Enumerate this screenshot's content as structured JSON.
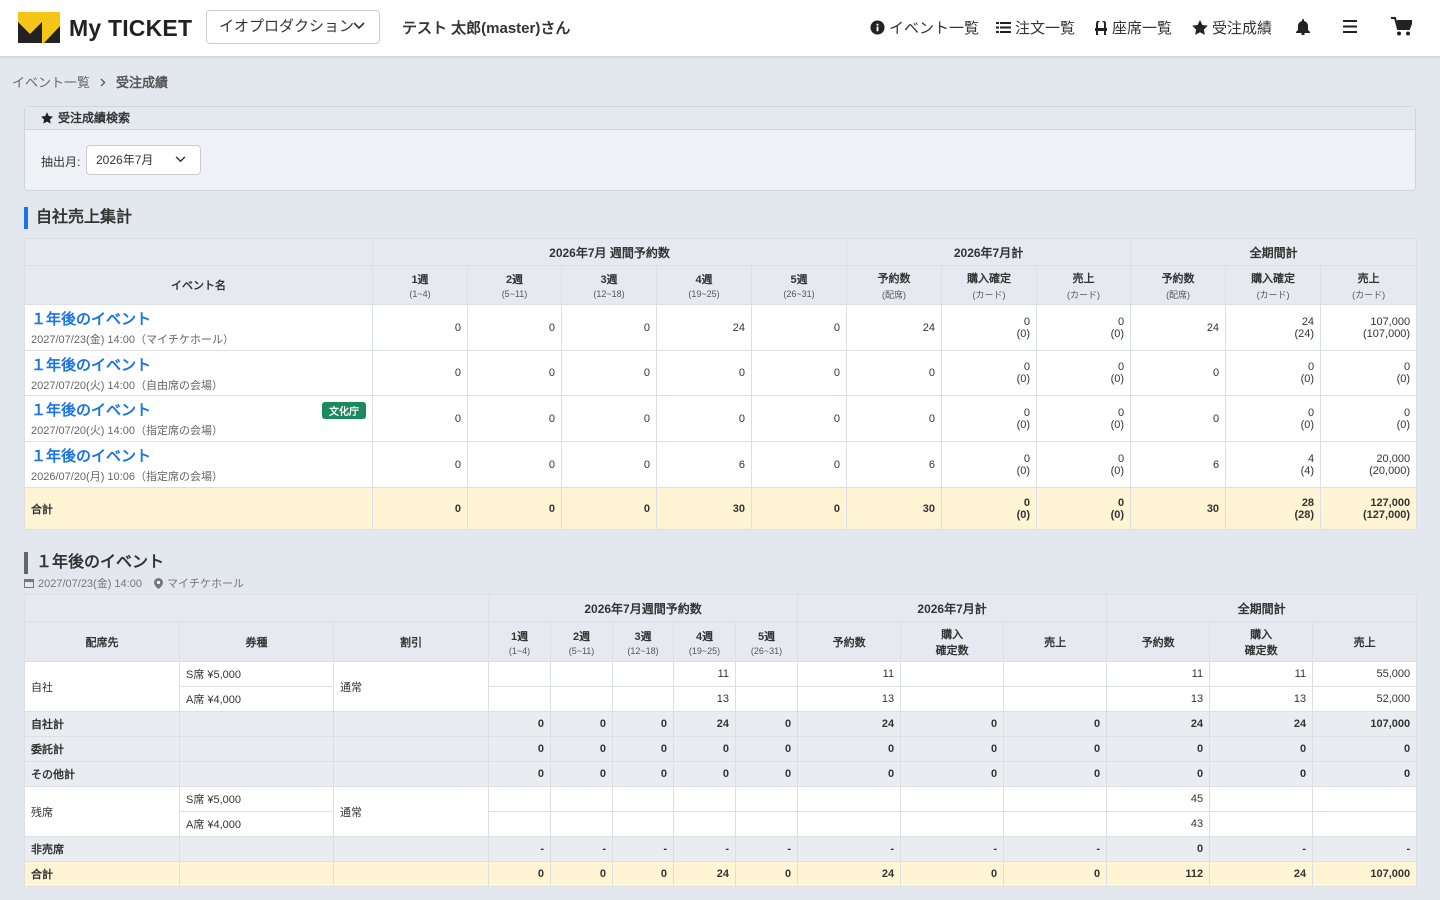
{
  "header": {
    "brand": "My TICKET",
    "org": "イオプロダクション",
    "user": "テスト 太郎(master)さん",
    "nav": {
      "events": "イベント一覧",
      "orders": "注文一覧",
      "seats": "座席一覧",
      "performance": "受注成績"
    }
  },
  "breadcrumb": {
    "home": "イベント一覧",
    "current": "受注成績"
  },
  "search": {
    "title": "受注成績検索",
    "month_label": "抽出月:",
    "month_value": "2026年7月"
  },
  "summary": {
    "title": "自社売上集計",
    "groups": [
      "2026年7月 週間予約数",
      "2026年7月計",
      "全期間計"
    ],
    "col_event": "イベント名",
    "weeks": [
      {
        "l": "1週",
        "r": "(1~4)"
      },
      {
        "l": "2週",
        "r": "(5~11)"
      },
      {
        "l": "3週",
        "r": "(12~18)"
      },
      {
        "l": "4週",
        "r": "(19~25)"
      },
      {
        "l": "5週",
        "r": "(26~31)"
      }
    ],
    "monthcols": [
      {
        "l": "予約数",
        "r": "(配席)"
      },
      {
        "l": "購入確定",
        "r": "(カード)"
      },
      {
        "l": "売上",
        "r": "(カード)"
      }
    ],
    "allcols": [
      {
        "l": "予約数",
        "r": "(配席)"
      },
      {
        "l": "購入確定",
        "r": "(カード)"
      },
      {
        "l": "売上",
        "r": "(カード)"
      }
    ],
    "rows": [
      {
        "name": "１年後のイベント",
        "sub": "2027/07/23(金) 14:00（マイチケホール）",
        "badge": "",
        "w": [
          "0",
          "0",
          "0",
          "24",
          "0"
        ],
        "m": [
          "24",
          "0",
          "(0)",
          "0",
          "(0)"
        ],
        "a": [
          "24",
          "24",
          "(24)",
          "107,000",
          "(107,000)"
        ]
      },
      {
        "name": "１年後のイベント",
        "sub": "2027/07/20(火) 14:00（自由席の会場）",
        "badge": "",
        "w": [
          "0",
          "0",
          "0",
          "0",
          "0"
        ],
        "m": [
          "0",
          "0",
          "(0)",
          "0",
          "(0)"
        ],
        "a": [
          "0",
          "0",
          "(0)",
          "0",
          "(0)"
        ]
      },
      {
        "name": "１年後のイベント",
        "sub": "2027/07/20(火) 14:00（指定席の会場）",
        "badge": "文化庁",
        "w": [
          "0",
          "0",
          "0",
          "0",
          "0"
        ],
        "m": [
          "0",
          "0",
          "(0)",
          "0",
          "(0)"
        ],
        "a": [
          "0",
          "0",
          "(0)",
          "0",
          "(0)"
        ]
      },
      {
        "name": "１年後のイベント",
        "sub": "2026/07/20(月) 10:06（指定席の会場）",
        "badge": "",
        "w": [
          "0",
          "0",
          "0",
          "6",
          "0"
        ],
        "m": [
          "6",
          "0",
          "(0)",
          "0",
          "(0)"
        ],
        "a": [
          "6",
          "4",
          "(4)",
          "20,000",
          "(20,000)"
        ]
      }
    ],
    "total": {
      "label": "合計",
      "w": [
        "0",
        "0",
        "0",
        "30",
        "0"
      ],
      "m": [
        "30",
        "0",
        "(0)",
        "0",
        "(0)"
      ],
      "a": [
        "30",
        "28",
        "(28)",
        "127,000",
        "(127,000)"
      ]
    }
  },
  "detail": {
    "title": "１年後のイベント",
    "datetime": "2027/07/23(金) 14:00",
    "venue": "マイチケホール",
    "groups": [
      "2026年7月週間予約数",
      "2026年7月計",
      "全期間計"
    ],
    "cols": {
      "dest": "配席先",
      "ticket": "券種",
      "discount": "割引"
    },
    "weeks": [
      {
        "l": "1週",
        "r": "(1~4)"
      },
      {
        "l": "2週",
        "r": "(5~11)"
      },
      {
        "l": "3週",
        "r": "(12~18)"
      },
      {
        "l": "4週",
        "r": "(19~25)"
      },
      {
        "l": "5週",
        "r": "(26~31)"
      }
    ],
    "mcols": [
      "予約数",
      "購入確定数",
      "売上"
    ],
    "acols": [
      "予約数",
      "購入確定数",
      "売上"
    ],
    "own": {
      "dest": "自社",
      "discount": "通常",
      "rows": [
        {
          "ticket": "S席 ¥5,000",
          "v": [
            "",
            "",
            "",
            "11",
            "",
            "11",
            "",
            "",
            "11",
            "11",
            "55,000"
          ]
        },
        {
          "ticket": "A席 ¥4,000",
          "v": [
            "",
            "",
            "",
            "13",
            "",
            "13",
            "",
            "",
            "13",
            "13",
            "52,000"
          ]
        }
      ]
    },
    "subtotals": [
      {
        "label": "自社計",
        "v": [
          "0",
          "0",
          "0",
          "24",
          "0",
          "24",
          "0",
          "0",
          "24",
          "24",
          "107,000"
        ]
      },
      {
        "label": "委託計",
        "v": [
          "0",
          "0",
          "0",
          "0",
          "0",
          "0",
          "0",
          "0",
          "0",
          "0",
          "0"
        ]
      },
      {
        "label": "その他計",
        "v": [
          "0",
          "0",
          "0",
          "0",
          "0",
          "0",
          "0",
          "0",
          "0",
          "0",
          "0"
        ]
      }
    ],
    "remain": {
      "dest": "残席",
      "discount": "通常",
      "rows": [
        {
          "ticket": "S席 ¥5,000",
          "v": [
            "",
            "",
            "",
            "",
            "",
            "",
            "",
            "",
            "45",
            "",
            ""
          ]
        },
        {
          "ticket": "A席 ¥4,000",
          "v": [
            "",
            "",
            "",
            "",
            "",
            "",
            "",
            "",
            "43",
            "",
            ""
          ]
        }
      ]
    },
    "nonsale": {
      "label": "非売席",
      "v": [
        "-",
        "-",
        "-",
        "-",
        "-",
        "-",
        "-",
        "-",
        "0",
        "-",
        "-"
      ]
    },
    "total": {
      "label": "合計",
      "v": [
        "0",
        "0",
        "0",
        "24",
        "0",
        "24",
        "0",
        "0",
        "112",
        "24",
        "107,000"
      ]
    }
  }
}
